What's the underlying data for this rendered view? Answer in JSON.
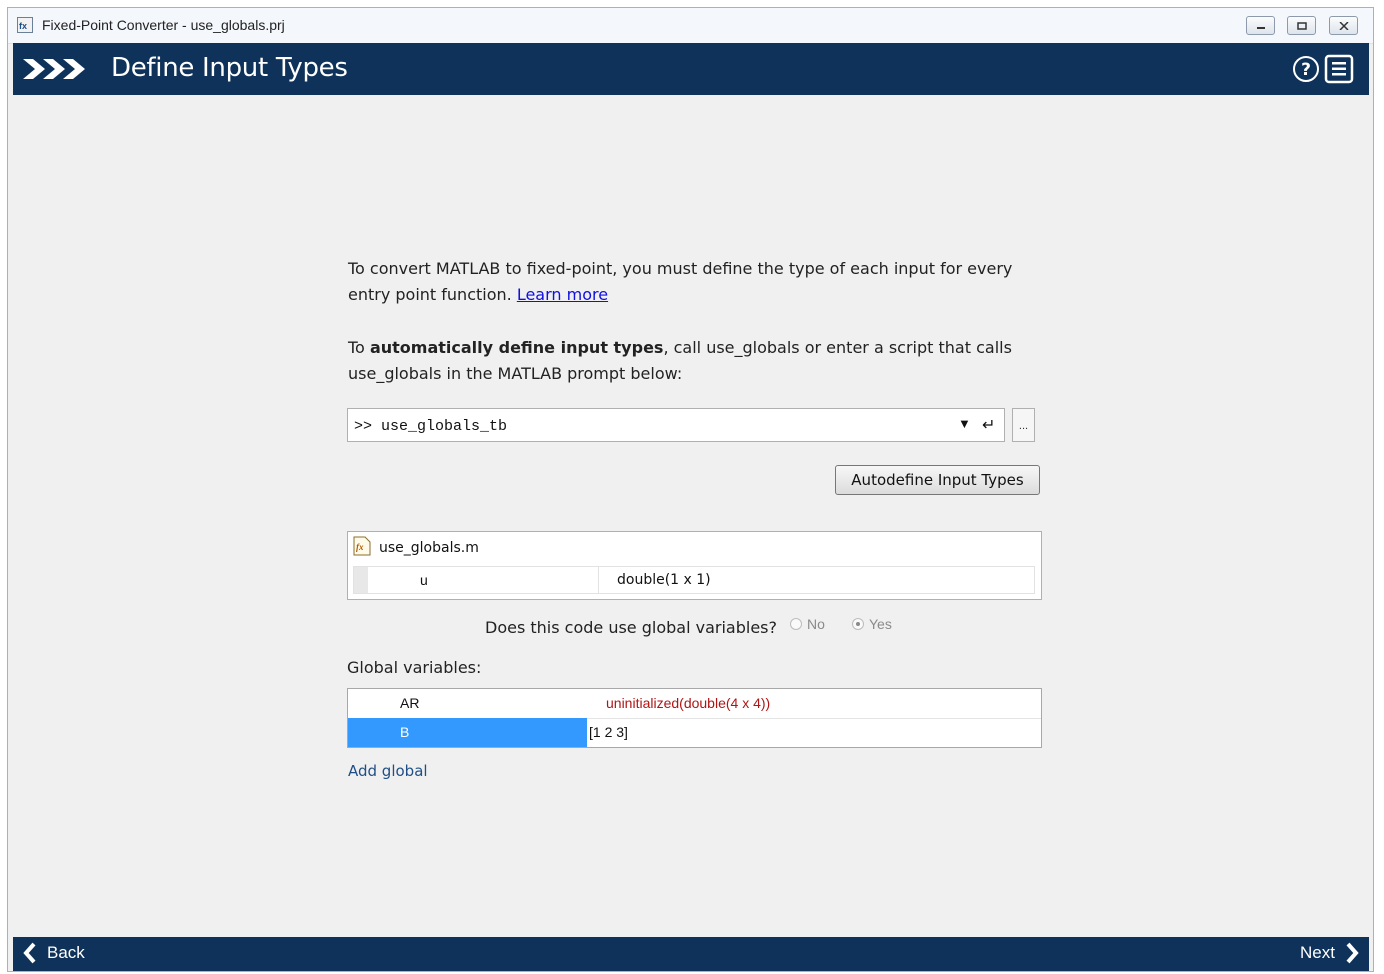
{
  "window": {
    "title": "Fixed-Point Converter - use_globals.prj"
  },
  "header": {
    "title": "Define Input Types",
    "help_icon": "question-circle-icon",
    "menu_icon": "menu-list-icon"
  },
  "intro": {
    "text": "To convert MATLAB to fixed-point, you must define the type of each input for every entry point function.",
    "link": "Learn more"
  },
  "auto": {
    "prefix": "To ",
    "bold": "automatically define input types",
    "suffix": ", call use_globals or enter a script that calls use_globals in the MATLAB prompt below:"
  },
  "prompt": {
    "value": ">> use_globals_tb",
    "dropdown_icon": "▼",
    "enter_icon": "↵",
    "browse_label": "..."
  },
  "autodefine_button": "Autodefine Input Types",
  "function_file": {
    "name": "use_globals.m",
    "inputs": [
      {
        "name": "u",
        "type": "double(1 x 1)"
      }
    ]
  },
  "globals_question": {
    "text": "Does this code use global variables?",
    "options": [
      "No",
      "Yes"
    ],
    "selected": "Yes"
  },
  "global_variables": {
    "label": "Global variables:",
    "rows": [
      {
        "name": "AR",
        "value": "uninitialized(double(4 x 4))"
      },
      {
        "name": "B",
        "value": "[1 2 3]"
      }
    ],
    "add_label": "Add global"
  },
  "footer": {
    "back": "Back",
    "next": "Next"
  },
  "colors": {
    "header_bg": "#0e3259",
    "selection": "#3399ff",
    "uninitialized": "#b01515",
    "link": "#1010e0"
  }
}
